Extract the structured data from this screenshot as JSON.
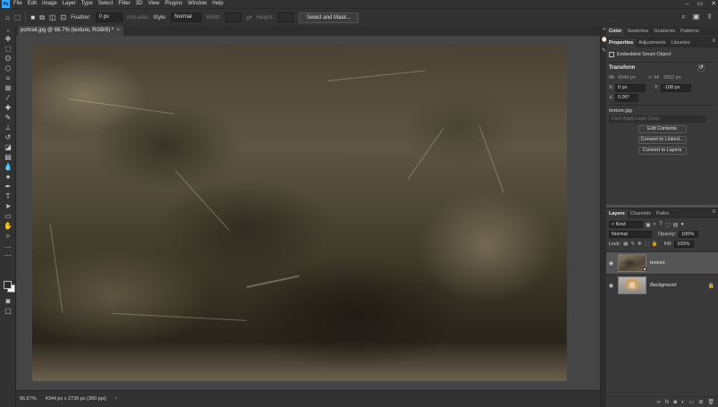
{
  "app": {
    "logo_text": "Ps"
  },
  "menu": [
    "File",
    "Edit",
    "Image",
    "Layer",
    "Type",
    "Select",
    "Filter",
    "3D",
    "View",
    "Plugins",
    "Window",
    "Help"
  ],
  "options_bar": {
    "feather_label": "Feather:",
    "feather_value": "0 px",
    "anti_alias_label": "Anti-alias",
    "style_label": "Style:",
    "style_value": "Normal",
    "width_label": "Width:",
    "height_label": "Height:",
    "select_mask_label": "Select and Mask..."
  },
  "document": {
    "tab_title": "portrait.jpg @ 66.7% (texture, RGB/8) *",
    "zoom": "66.67%",
    "info": "4344 px x 2736 px (300 ppi)"
  },
  "panels": {
    "color_tabs": [
      "Color",
      "Swatches",
      "Gradients",
      "Patterns"
    ],
    "props_tabs": [
      "Properties",
      "Adjustments",
      "Libraries"
    ],
    "layers_tabs": [
      "Layers",
      "Channels",
      "Paths"
    ]
  },
  "properties": {
    "object_type": "Embedded Smart Object",
    "transform_title": "Transform",
    "w_label": "W:",
    "w_value": "4344 px",
    "h_label": "H:",
    "h_value": "2952 px",
    "x_label": "X:",
    "x_value": "0 px",
    "y_label": "Y:",
    "y_value": "-108 px",
    "angle_value": "0.00°",
    "filename": "texture.jpg",
    "layer_comp_placeholder": "Don't Apply Layer Comp",
    "buttons": [
      "Edit Contents",
      "Convert to Linked...",
      "Convert to Layers"
    ]
  },
  "layers": {
    "kind_label": "Kind",
    "blend_mode": "Normal",
    "opacity_label": "Opacity:",
    "opacity_value": "100%",
    "lock_label": "Lock:",
    "fill_label": "Fill:",
    "fill_value": "100%",
    "items": [
      {
        "name": "texture",
        "selected": true,
        "italic": false
      },
      {
        "name": "Background",
        "selected": false,
        "italic": true
      }
    ]
  }
}
